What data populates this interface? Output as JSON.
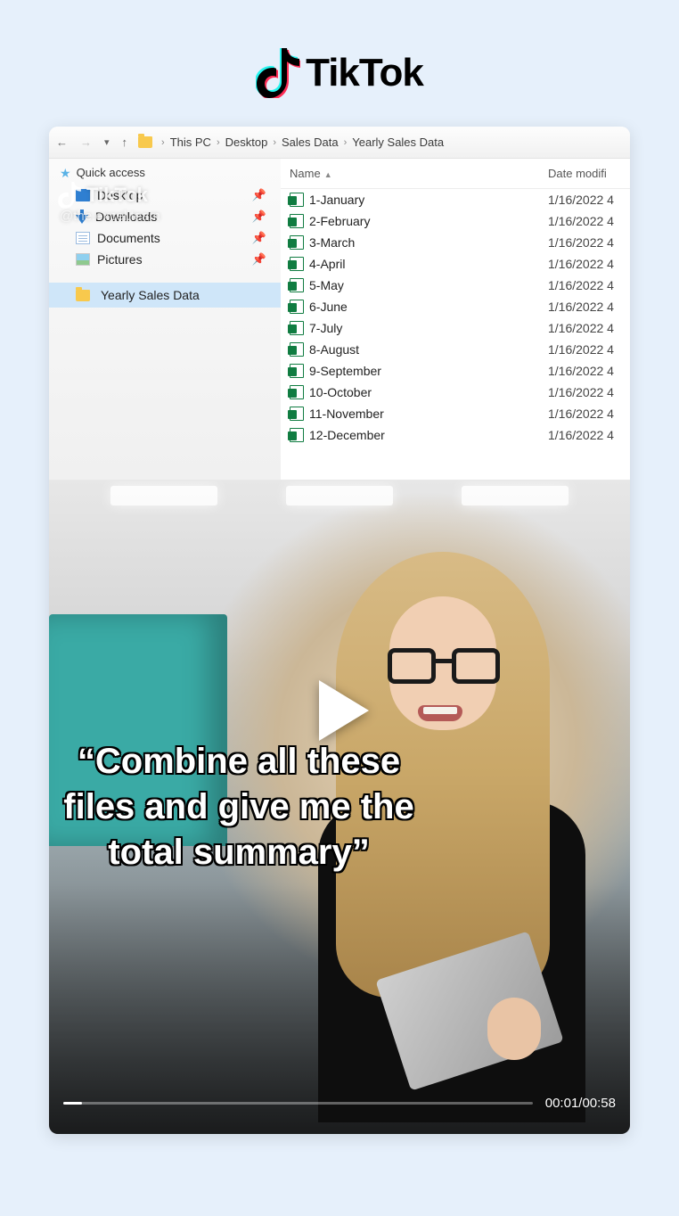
{
  "brand": {
    "name": "TikTok"
  },
  "watermark": {
    "text": "TikTok",
    "handle": "@the.excel.team"
  },
  "explorer": {
    "breadcrumb": [
      "This PC",
      "Desktop",
      "Sales Data",
      "Yearly Sales Data"
    ],
    "quick_access_label": "Quick access",
    "quick_items": [
      {
        "label": "Desktop"
      },
      {
        "label": "Downloads"
      },
      {
        "label": "Documents"
      },
      {
        "label": "Pictures"
      }
    ],
    "selected_folder": "Yearly Sales Data",
    "columns": {
      "name": "Name",
      "date": "Date modifi"
    },
    "files": [
      {
        "name": "1-January",
        "date": "1/16/2022 4"
      },
      {
        "name": "2-February",
        "date": "1/16/2022 4"
      },
      {
        "name": "3-March",
        "date": "1/16/2022 4"
      },
      {
        "name": "4-April",
        "date": "1/16/2022 4"
      },
      {
        "name": "5-May",
        "date": "1/16/2022 4"
      },
      {
        "name": "6-June",
        "date": "1/16/2022 4"
      },
      {
        "name": "7-July",
        "date": "1/16/2022 4"
      },
      {
        "name": "8-August",
        "date": "1/16/2022 4"
      },
      {
        "name": "9-September",
        "date": "1/16/2022 4"
      },
      {
        "name": "10-October",
        "date": "1/16/2022 4"
      },
      {
        "name": "11-November",
        "date": "1/16/2022 4"
      },
      {
        "name": "12-December",
        "date": "1/16/2022 4"
      }
    ]
  },
  "video": {
    "caption": "“Combine all these files and give me the total summary”",
    "time_current": "00:01",
    "time_total": "00:58",
    "time_display": "00:01/00:58",
    "progress_pct": 4
  }
}
